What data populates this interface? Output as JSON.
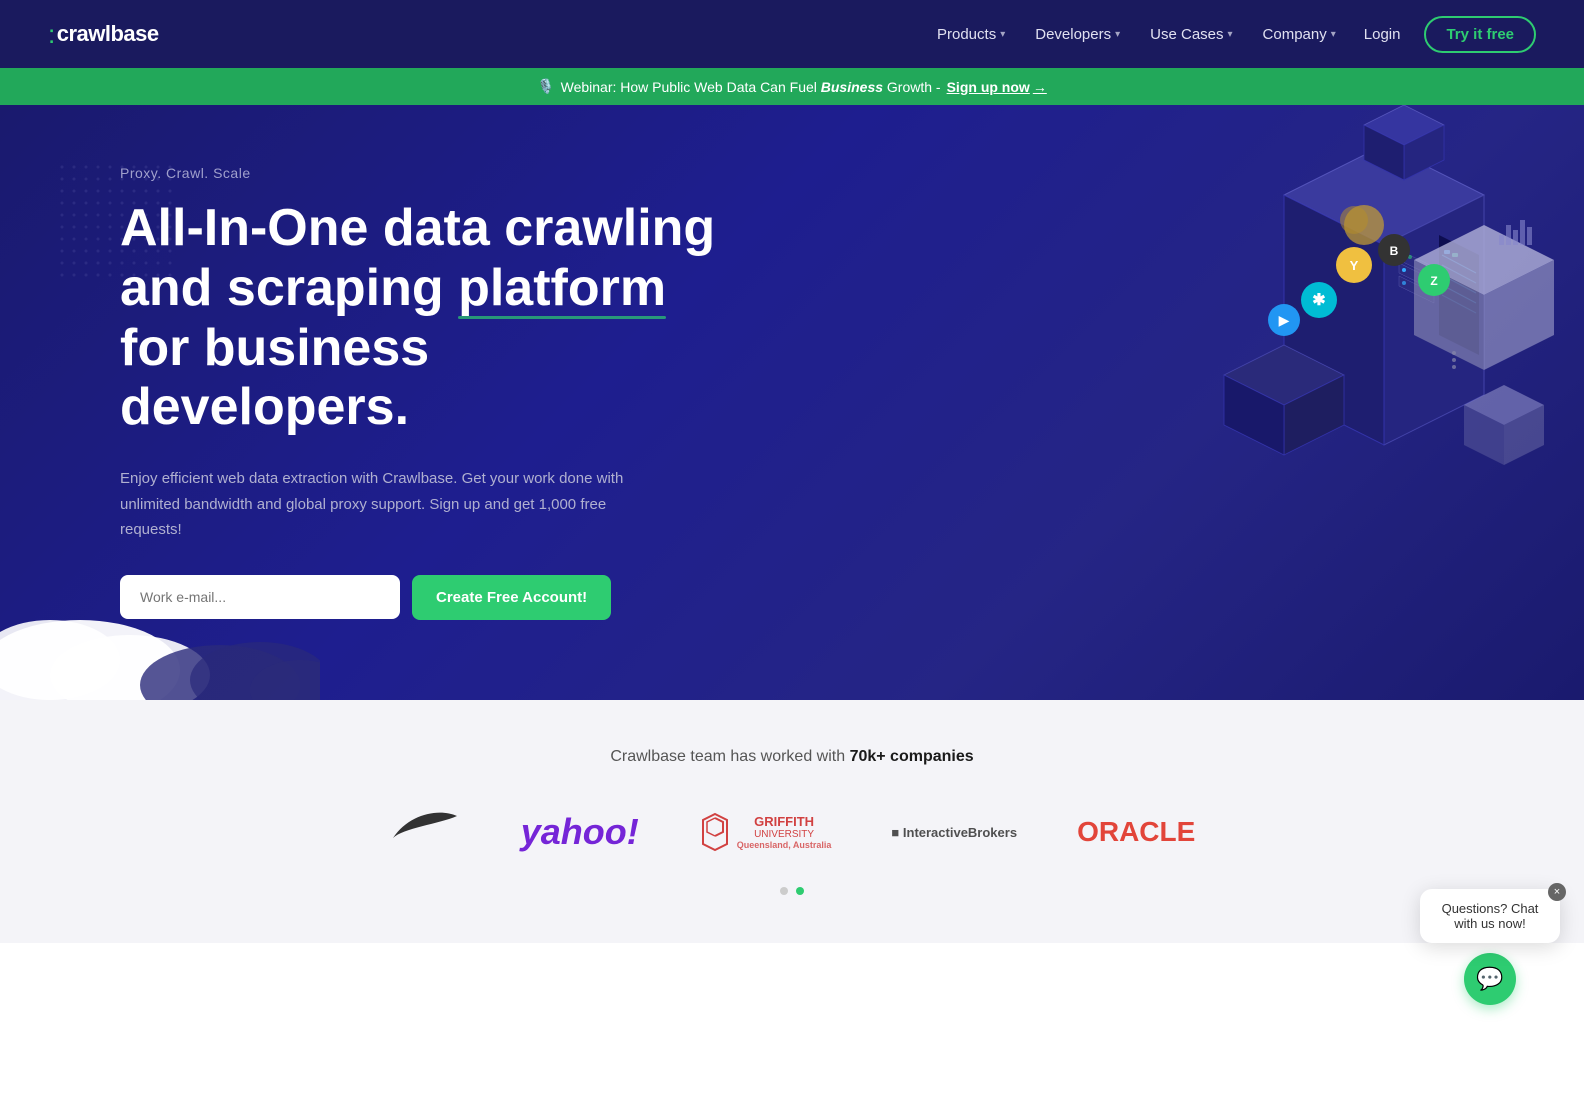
{
  "brand": {
    "name": "crawlbase",
    "logo_bracket": "["
  },
  "navbar": {
    "links": [
      {
        "label": "Products",
        "has_dropdown": true
      },
      {
        "label": "Developers",
        "has_dropdown": true
      },
      {
        "label": "Use Cases",
        "has_dropdown": true
      },
      {
        "label": "Company",
        "has_dropdown": true
      }
    ],
    "login_label": "Login",
    "cta_label": "Try it free"
  },
  "banner": {
    "text_pre": "Webinar: How Public Web Data Can Fuel",
    "text_italic": "Business",
    "text_post": "Growth -",
    "link_text": "Sign up now",
    "emoji": "🎙️"
  },
  "hero": {
    "tag": "Proxy. Crawl. Scale",
    "title_part1": "All-In-One data crawling and scraping ",
    "title_highlight": "platform",
    "title_part2": " for business developers.",
    "description": "Enjoy efficient web data extraction with Crawlbase. Get your work done with unlimited bandwidth and global proxy support. Sign up and get 1,000 free requests!",
    "email_placeholder": "Work e-mail...",
    "cta_button": "Create Free Account!"
  },
  "companies": {
    "title_pre": "Crawlbase team has worked with",
    "title_bold": "70k+ companies",
    "logos": [
      {
        "name": "Nike",
        "style": "nike"
      },
      {
        "name": "Yahoo!",
        "style": "yahoo"
      },
      {
        "name": "Griffith University",
        "style": "griffith"
      },
      {
        "name": "InteractiveBrokers",
        "style": "ib"
      },
      {
        "name": "ORACLE",
        "style": "oracle"
      }
    ],
    "dots": [
      {
        "active": false
      },
      {
        "active": true
      }
    ]
  },
  "chat": {
    "bubble_text": "Questions? Chat with us now!",
    "close_label": "×"
  },
  "colors": {
    "nav_bg": "#1a1a5e",
    "hero_bg": "#1e1e8f",
    "banner_bg": "#22a85a",
    "accent_green": "#2ecc71",
    "companies_bg": "#f4f4f8"
  }
}
